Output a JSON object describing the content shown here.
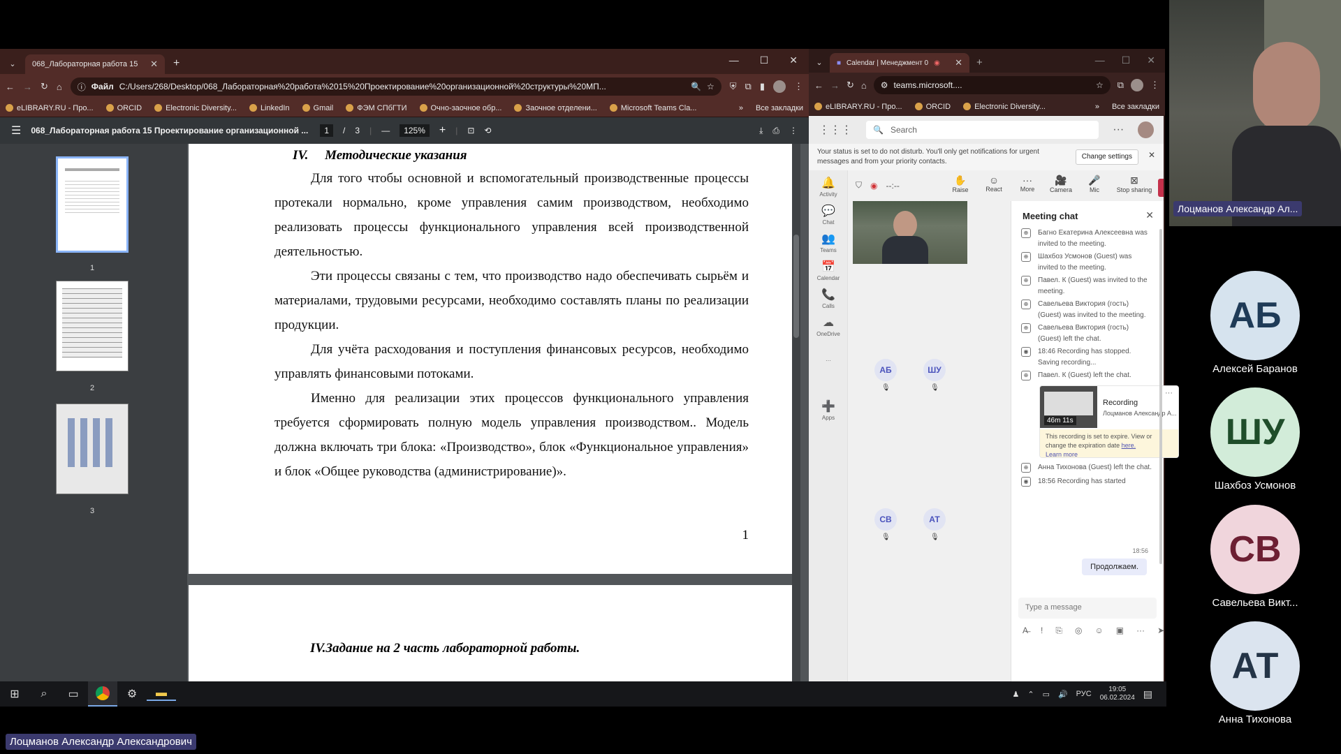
{
  "left_browser": {
    "tab_title": "068_Лабораторная работа 15",
    "address": "C:/Users/268/Desktop/068_Лабораторная%20работа%2015%20Проектирование%20организационной%20структуры%20МП...",
    "address_prefix": "Файл",
    "bookmarks": [
      "eLIBRARY.RU - Про...",
      "ORCID",
      "Electronic Diversity...",
      "LinkedIn",
      "Gmail",
      "ФЭМ СПбГТИ",
      "Очно-заочное обр...",
      "Заочное отделени...",
      "Microsoft Teams Cla..."
    ],
    "bookmarks_all": "Все закладки"
  },
  "pdf": {
    "doc_title": "068_Лабораторная работа 15 Проектирование организационной ...",
    "page_current": "1",
    "page_sep": "/",
    "page_total": "3",
    "zoom": "125%",
    "thumb_labels": [
      "1",
      "2",
      "3"
    ],
    "heading": "IV.     Методические указания",
    "paragraphs": [
      "Для того чтобы основной и вспомогательный производственные процессы протекали нормально, кроме управления самим производством, необходимо реализовать процессы функционального управления всей производственной деятельностью.",
      "Эти процессы связаны с тем, что производство надо обеспечивать сырьём и материалами, трудовыми ресурсами, необходимо составлять планы по реализации продукции.",
      "Для учёта расходования и поступления финансовых ресурсов, необходимо управлять финансовыми потоками.",
      "Именно для реализации этих процессов функционального управления требуется сформировать полную модель управления производством.. Модель должна включать три блока: «Производство», блок «Функциональное управления» и блок «Общее руководства (администрирование)»."
    ],
    "page_number": "1",
    "next_heading": "IV.Задание на 2 часть лабораторной работы."
  },
  "right_browser": {
    "tab_title": "Calendar | Менеджмент 0",
    "address": "teams.microsoft....",
    "bookmarks": [
      "eLIBRARY.RU - Про...",
      "ORCID",
      "Electronic Diversity..."
    ],
    "bookmarks_all": "Все закладки"
  },
  "teams": {
    "search_placeholder": "Search",
    "banner_text": "Your status is set to do not disturb. You'll only get notifications for urgent messages and from your priority contacts.",
    "banner_button": "Change settings",
    "rail": [
      "Activity",
      "Chat",
      "Teams",
      "Calendar",
      "Calls",
      "OneDrive",
      "Apps"
    ],
    "timer": "--:--",
    "controls": [
      "Raise",
      "React",
      "More",
      "Camera",
      "Mic",
      "Stop sharing"
    ],
    "participants": [
      "АБ",
      "ШУ",
      "СВ",
      "АТ"
    ],
    "chat_title": "Meeting chat",
    "chat_events": [
      "Багно Екатерина Алексеевна was invited to the meeting.",
      "Шахбоз Усмонов (Guest) was invited to the meeting.",
      "Павел. К (Guest) was invited to the meeting.",
      "Савельева Виктория (гость) (Guest) was invited to the meeting.",
      "Савельева Виктория (гость) (Guest) left the chat.",
      "18:46   Recording has stopped. Saving recording...",
      "Павел. К (Guest) left the chat."
    ],
    "recording_title": "Recording",
    "recording_author": "Лоцманов Александр А...",
    "recording_duration": "46m 11s",
    "recording_note": "This recording is set to expire. View or change the expiration date",
    "recording_here": "here.",
    "recording_learn": "Learn more",
    "chat_events2": [
      "Анна Тихонова (Guest) left the chat.",
      "18:56   Recording has started"
    ],
    "msg_time": "18:56",
    "msg_text": "Продолжаем.",
    "input_placeholder": "Type a message"
  },
  "taskbar": {
    "lang": "РУС",
    "time": "19:05",
    "date": "06.02.2024"
  },
  "presenter_label": "Лоцманов Александр Александрович",
  "speaker_tile_label": "Лоцманов Александр Ал...",
  "video_tiles": [
    {
      "initials": "АБ",
      "name": "Алексей Баранов",
      "bg": "#d6e3ee",
      "fg": "#1f3b57"
    },
    {
      "initials": "ШУ",
      "name": "Шахбоз Усмонов",
      "bg": "#d2ecd9",
      "fg": "#1f4d2a"
    },
    {
      "initials": "СВ",
      "name": "Савельева Викт...",
      "bg": "#f0d5dc",
      "fg": "#6d1f33"
    },
    {
      "initials": "АТ",
      "name": "Анна Тихонова",
      "bg": "#dbe4ef",
      "fg": "#243447"
    }
  ]
}
